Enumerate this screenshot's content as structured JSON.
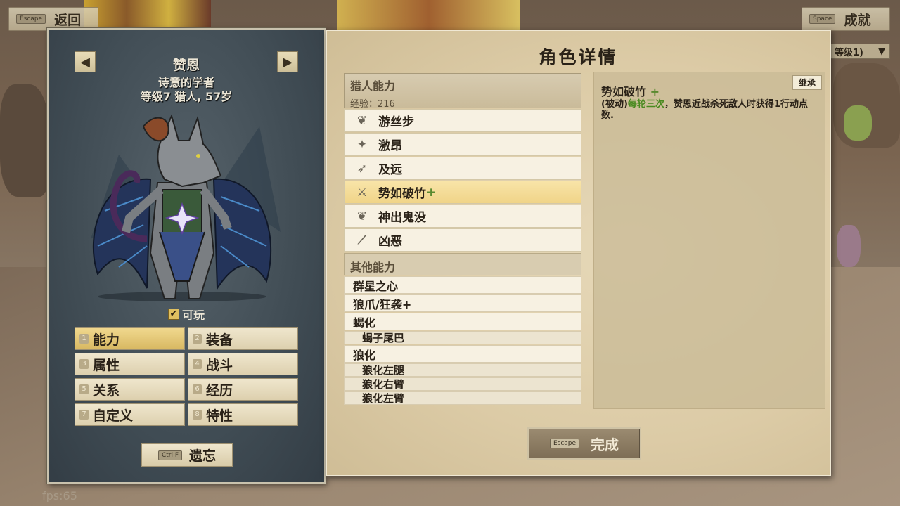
{
  "top_bar": {
    "back_key": "Escape",
    "back_label": "返回",
    "achieve_key": "Space",
    "achieve_label": "成就",
    "right_sub": "等级1)"
  },
  "character": {
    "name": "赞恩",
    "title": "诗意的学者",
    "level_line": "等级7 猎人, 57岁",
    "playable_label": "可玩",
    "playable_checked": true
  },
  "tabs": [
    {
      "num": "1",
      "label": "能力",
      "active": true
    },
    {
      "num": "2",
      "label": "装备",
      "active": false
    },
    {
      "num": "3",
      "label": "属性",
      "active": false
    },
    {
      "num": "4",
      "label": "战斗",
      "active": false
    },
    {
      "num": "5",
      "label": "关系",
      "active": false
    },
    {
      "num": "6",
      "label": "经历",
      "active": false
    },
    {
      "num": "7",
      "label": "自定义",
      "active": false
    },
    {
      "num": "8",
      "label": "特性",
      "active": false
    }
  ],
  "forget": {
    "key": "Ctrl F",
    "label": "遗忘"
  },
  "fps": "fps:65",
  "panel": {
    "title": "角色详情",
    "hunter_section": "猎人能力",
    "xp_line": "经验：216",
    "abilities": [
      {
        "label": "游丝步",
        "icon": "feather-icon",
        "plus": ""
      },
      {
        "label": "激昂",
        "icon": "sparkle-icon",
        "plus": ""
      },
      {
        "label": "及远",
        "icon": "arrow-streak-icon",
        "plus": ""
      },
      {
        "label": "势如破竹",
        "icon": "sword-strike-icon",
        "plus": "+"
      },
      {
        "label": "神出鬼没",
        "icon": "cloak-icon",
        "plus": ""
      },
      {
        "label": "凶恶",
        "icon": "claw-icon",
        "plus": ""
      }
    ],
    "other_section": "其他能力",
    "other_abilities": [
      {
        "label": "群星之心",
        "sub": false
      },
      {
        "label": "狼爪/狂袭+",
        "sub": false
      },
      {
        "label": "蝎化",
        "sub": false
      },
      {
        "label": "蝎子尾巴",
        "sub": true
      },
      {
        "label": "狼化",
        "sub": false
      },
      {
        "label": "狼化左腿",
        "sub": true
      },
      {
        "label": "狼化右臂",
        "sub": true
      },
      {
        "label": "狼化左臂",
        "sub": true
      }
    ],
    "detail": {
      "tag": "继承",
      "title": "势如破竹",
      "title_plus": "+",
      "desc_prefix": "(被动)",
      "desc_highlight": "每轮三次",
      "desc_rest": "，赞恩近战杀死敌人时获得1行动点数."
    },
    "done_key": "Escape",
    "done_label": "完成"
  },
  "colors": {
    "accent_gold": "#f0d488",
    "highlight_green": "#4a8a20",
    "left_panel": "#404c54"
  }
}
